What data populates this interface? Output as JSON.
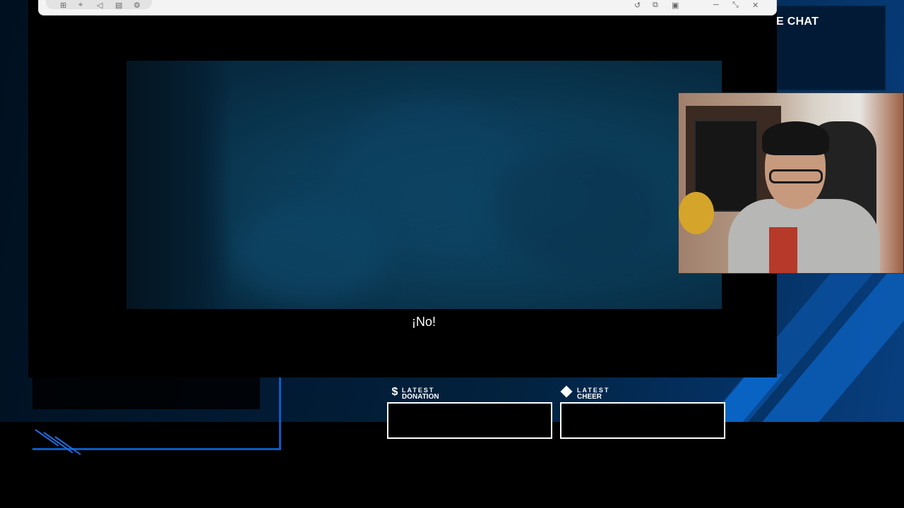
{
  "overlay": {
    "chat_title": "E CHAT",
    "accent_color": "#0a5cc7"
  },
  "window": {
    "toolbar_icons": [
      "grid-icon",
      "tag-icon",
      "speaker-icon",
      "list-icon",
      "gear-icon"
    ],
    "controls": [
      "undo-icon",
      "copy-icon",
      "pip-icon",
      "minimize-icon",
      "restore-icon",
      "close-icon"
    ]
  },
  "player": {
    "subtitle": "¡No!"
  },
  "widgets": {
    "donation": {
      "top": "LATEST",
      "label": "DONATION",
      "icon": "$"
    },
    "cheer": {
      "top": "LATEST",
      "label": "CHEER"
    }
  }
}
